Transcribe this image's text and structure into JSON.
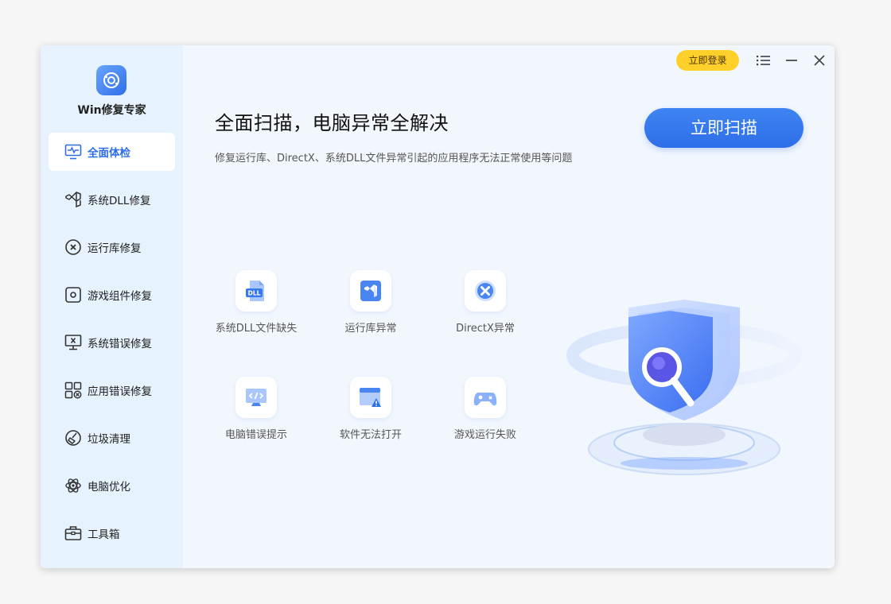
{
  "app": {
    "name": "Win修复专家"
  },
  "topbar": {
    "login_label": "立即登录",
    "menu_icon": "menu-icon",
    "minimize_icon": "minimize-icon",
    "close_icon": "close-icon"
  },
  "sidebar": {
    "items": [
      {
        "label": "全面体检",
        "icon": "monitor-pulse-icon",
        "active": true
      },
      {
        "label": "系统DLL修复",
        "icon": "visual-studio-icon"
      },
      {
        "label": "运行库修复",
        "icon": "circle-x-icon"
      },
      {
        "label": "游戏组件修复",
        "icon": "gear-square-icon"
      },
      {
        "label": "系统错误修复",
        "icon": "monitor-x-icon"
      },
      {
        "label": "应用错误修复",
        "icon": "app-grid-x-icon"
      },
      {
        "label": "垃圾清理",
        "icon": "broom-icon"
      },
      {
        "label": "电脑优化",
        "icon": "atom-icon"
      },
      {
        "label": "工具箱",
        "icon": "toolbox-icon"
      }
    ]
  },
  "main": {
    "headline": "全面扫描，电脑异常全解决",
    "subline": "修复运行库、DirectX、系统DLL文件异常引起的应用程序无法正常使用等问题",
    "scan_button": "立即扫描",
    "features": [
      {
        "label": "系统DLL文件缺失",
        "icon": "dll-file-icon"
      },
      {
        "label": "运行库异常",
        "icon": "visual-studio-icon"
      },
      {
        "label": "DirectX异常",
        "icon": "directx-icon"
      },
      {
        "label": "电脑错误提示",
        "icon": "code-monitor-icon"
      },
      {
        "label": "软件无法打开",
        "icon": "window-warning-icon"
      },
      {
        "label": "游戏运行失败",
        "icon": "gamepad-icon"
      }
    ]
  },
  "colors": {
    "accent": "#2e6ee8",
    "login": "#ffd02a",
    "sidebar_bg": "#e6f2fd",
    "main_bg": "#f2f7fe"
  }
}
